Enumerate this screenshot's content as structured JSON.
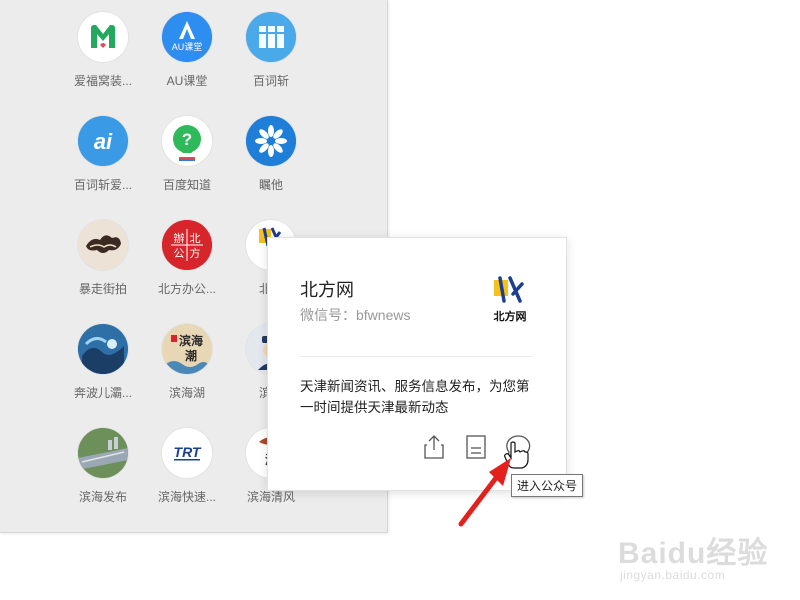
{
  "apps": [
    {
      "label": "爱福窝装...",
      "icon": "m-logo-icon",
      "color": "#1fae6a"
    },
    {
      "label": "AU课堂",
      "icon": "au-logo-icon",
      "color": "#2e8df0",
      "text": "AU课堂"
    },
    {
      "label": "百词斩",
      "icon": "baicizhan-logo-icon",
      "color": "#4aa9e8"
    },
    {
      "label": "百词斩爱...",
      "icon": "ai-logo-icon",
      "color": "#3a9ae6",
      "text": "ai"
    },
    {
      "label": "百度知道",
      "icon": "question-logo-icon",
      "color": "#2fb95a",
      "text": "?"
    },
    {
      "label": "瞩他",
      "icon": "flower-logo-icon",
      "color": "#1f7fd8"
    },
    {
      "label": "暴走街拍",
      "icon": "street-logo-icon",
      "color": "#e9d8c8"
    },
    {
      "label": "北方办公...",
      "icon": "office-logo-icon",
      "color": "#d6252b",
      "text": "辦北公方"
    },
    {
      "label": "北方",
      "icon": "beifang-logo-icon",
      "color": "#ffffff"
    },
    {
      "label": "奔波儿灞...",
      "icon": "wave-logo-icon",
      "color": "#2f6fa8"
    },
    {
      "label": "滨海湖",
      "icon": "binhaihu-logo-icon",
      "color": "#e8d7b5",
      "text": "滨海潮"
    },
    {
      "label": "滨海",
      "icon": "police-logo-icon",
      "color": "#c9d2de"
    },
    {
      "label": "滨海发布",
      "icon": "city-logo-icon",
      "color": "#6d8f5a"
    },
    {
      "label": "滨海快速...",
      "icon": "trt-logo-icon",
      "color": "#ffffff",
      "text": "TRT"
    },
    {
      "label": "滨海清风",
      "icon": "qingfeng-logo-icon",
      "color": "#ffffff",
      "text": "滨"
    }
  ],
  "card": {
    "name": "北方网",
    "wechat_id": "微信号：bfwnews",
    "logo_text": "北方网",
    "description": "天津新闻资讯、服务信息发布，为您第一时间提供天津最新动态"
  },
  "tooltip": "进入公众号",
  "watermark": {
    "main": "Baidu经验",
    "sub": "jingyan.baidu.com"
  },
  "colors": {
    "panel_bg": "#ececec",
    "arrow": "#e3201b"
  }
}
